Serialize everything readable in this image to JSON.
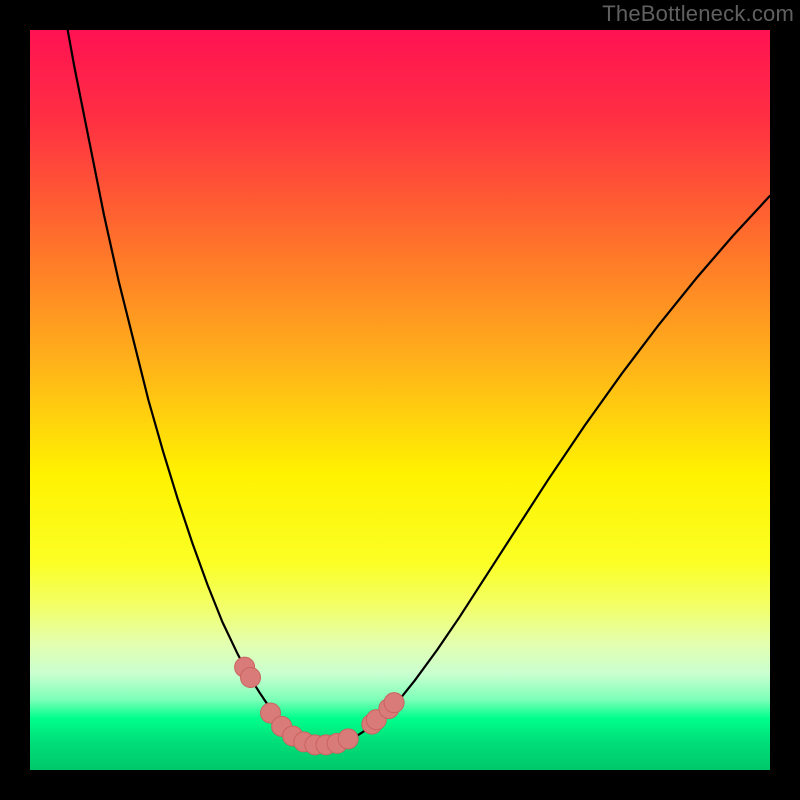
{
  "watermark": "TheBottleneck.com",
  "colors": {
    "frame": "#000000",
    "curve": "#000000",
    "markers_fill": "#d97b78",
    "markers_stroke": "#c9635f"
  },
  "gradient_stops": [
    {
      "offset": 0.0,
      "color": "#ff1252"
    },
    {
      "offset": 0.12,
      "color": "#ff2f43"
    },
    {
      "offset": 0.28,
      "color": "#ff6e2c"
    },
    {
      "offset": 0.45,
      "color": "#ffb21a"
    },
    {
      "offset": 0.6,
      "color": "#fff200"
    },
    {
      "offset": 0.72,
      "color": "#fbff25"
    },
    {
      "offset": 0.78,
      "color": "#f2ff6a"
    },
    {
      "offset": 0.83,
      "color": "#e3ffb0"
    },
    {
      "offset": 0.87,
      "color": "#c9ffd0"
    },
    {
      "offset": 0.905,
      "color": "#7cffb8"
    },
    {
      "offset": 0.93,
      "color": "#00ff8c"
    },
    {
      "offset": 0.96,
      "color": "#00e07a"
    },
    {
      "offset": 1.0,
      "color": "#00c86a"
    }
  ],
  "chart_data": {
    "type": "line",
    "title": "",
    "xlabel": "",
    "ylabel": "",
    "xlim": [
      0,
      100
    ],
    "ylim": [
      0,
      100
    ],
    "grid": false,
    "legend": false,
    "x": [
      0,
      2,
      4,
      6,
      8,
      10,
      12,
      14,
      16,
      18,
      20,
      22,
      24,
      26,
      28,
      29,
      30,
      31,
      32,
      33,
      34,
      35,
      36,
      37,
      38,
      39,
      40,
      42,
      44,
      46,
      48,
      50,
      52,
      55,
      58,
      62,
      66,
      70,
      75,
      80,
      85,
      90,
      95,
      100
    ],
    "values": [
      130,
      118,
      106,
      95,
      85,
      75,
      66,
      58,
      50,
      43,
      36.5,
      30.5,
      25,
      20,
      15.8,
      13.9,
      12.1,
      10.5,
      9.0,
      7.7,
      6.5,
      5.5,
      4.7,
      4.0,
      3.6,
      3.4,
      3.4,
      3.7,
      4.5,
      5.8,
      7.5,
      9.6,
      12.1,
      16.2,
      20.6,
      26.8,
      33.0,
      39.2,
      46.6,
      53.6,
      60.2,
      66.4,
      72.2,
      77.6
    ],
    "comment": "y is bottleneck-like mismatch percentage; plotted as 100 - y on a 0..100 canvas so 0=bottom, 100=top; minimum ~3.4 near x≈39",
    "markers": [
      {
        "x": 29.0,
        "y": 13.9
      },
      {
        "x": 29.8,
        "y": 12.5
      },
      {
        "x": 32.5,
        "y": 7.7
      },
      {
        "x": 34.0,
        "y": 5.9
      },
      {
        "x": 35.5,
        "y": 4.6
      },
      {
        "x": 37.0,
        "y": 3.8
      },
      {
        "x": 38.5,
        "y": 3.4
      },
      {
        "x": 40.0,
        "y": 3.4
      },
      {
        "x": 41.5,
        "y": 3.6
      },
      {
        "x": 43.0,
        "y": 4.2
      },
      {
        "x": 46.2,
        "y": 6.2
      },
      {
        "x": 46.8,
        "y": 6.8
      },
      {
        "x": 48.5,
        "y": 8.3
      },
      {
        "x": 49.2,
        "y": 9.1
      }
    ]
  }
}
